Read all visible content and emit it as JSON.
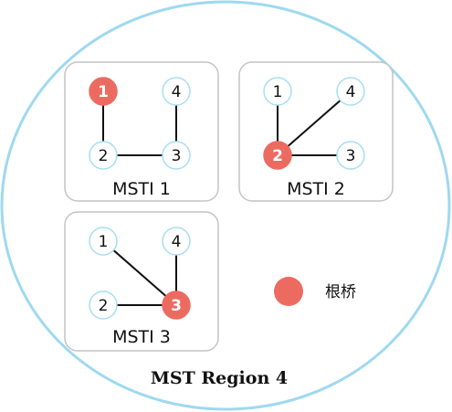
{
  "region": {
    "title": "MST Region 4"
  },
  "colors": {
    "region_stroke": "#9ed9f0",
    "box_stroke": "#c4c4c4",
    "node_stroke": "#a6dff2",
    "root_fill": "#ec6b60",
    "link": "#111111"
  },
  "instances": [
    {
      "label": "MSTI 1",
      "root": "1",
      "nodes": [
        "1",
        "4",
        "2",
        "3"
      ],
      "links": [
        [
          "1",
          "2"
        ],
        [
          "2",
          "3"
        ],
        [
          "3",
          "4"
        ]
      ]
    },
    {
      "label": "MSTI 2",
      "root": "2",
      "nodes": [
        "1",
        "4",
        "2",
        "3"
      ],
      "links": [
        [
          "1",
          "2"
        ],
        [
          "2",
          "4"
        ],
        [
          "2",
          "3"
        ]
      ]
    },
    {
      "label": "MSTI 3",
      "root": "3",
      "nodes": [
        "1",
        "4",
        "2",
        "3"
      ],
      "links": [
        [
          "1",
          "3"
        ],
        [
          "2",
          "3"
        ],
        [
          "3",
          "4"
        ]
      ]
    }
  ],
  "legend": {
    "label": "根桥",
    "icon": "root-bridge-dot-icon"
  }
}
